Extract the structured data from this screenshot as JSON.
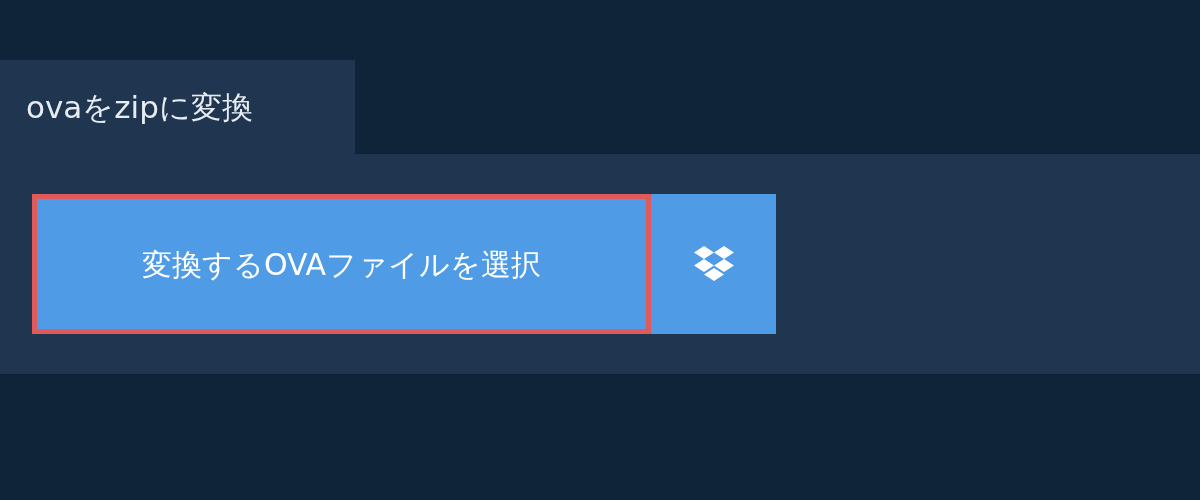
{
  "tab": {
    "label": "ovaをzipに変換",
    "selected": true
  },
  "buttons": [
    {
      "kind": "file",
      "label": "変換するOVAファイルを選択",
      "focused": true
    },
    {
      "kind": "dropbox",
      "focused": false
    }
  ]
}
